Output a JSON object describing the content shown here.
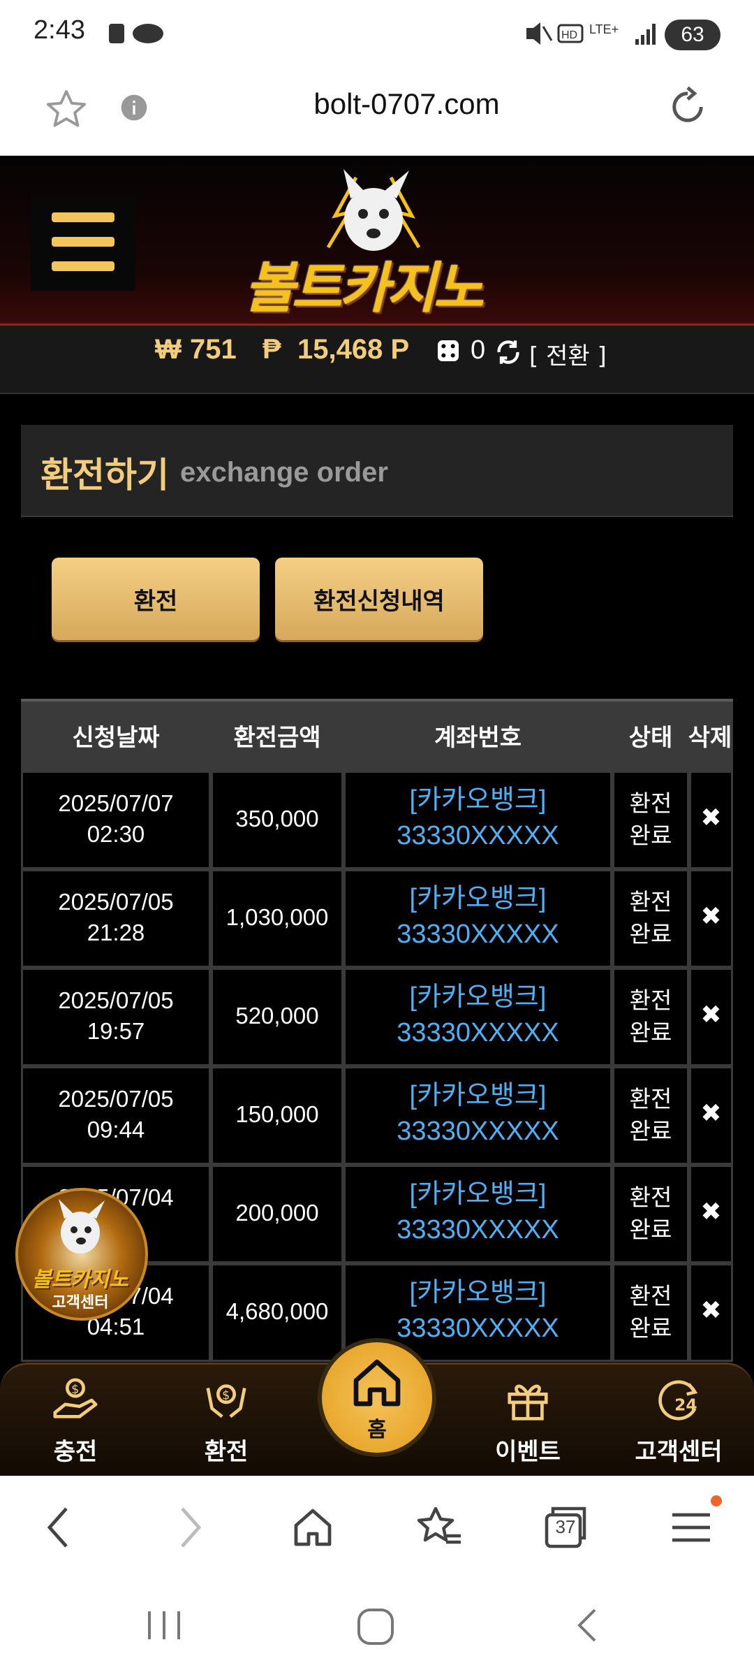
{
  "status_bar": {
    "time": "2:43",
    "battery": "63"
  },
  "browser": {
    "url": "bolt-0707.com",
    "tab_count": "37"
  },
  "site": {
    "logo_text": "볼트카지노",
    "balance": {
      "won_symbol": "₩",
      "won_value": "751",
      "point_symbol": "₱",
      "point_value": "15,468 P",
      "dice_value": "0",
      "convert_label": "[ 전환 ]"
    }
  },
  "exchange": {
    "title": "환전하기",
    "subtitle": "exchange order",
    "tabs": [
      "환전",
      "환전신청내역"
    ],
    "columns": [
      "신청날짜",
      "환전금액",
      "계좌번호",
      "상태",
      "삭제"
    ],
    "rows": [
      {
        "date": "2025/07/07",
        "time": "02:30",
        "amount": "350,000",
        "bank": "[카카오뱅크]",
        "account": "33330XXXXX",
        "status_1": "환전",
        "status_2": "완료"
      },
      {
        "date": "2025/07/05",
        "time": "21:28",
        "amount": "1,030,000",
        "bank": "[카카오뱅크]",
        "account": "33330XXXXX",
        "status_1": "환전",
        "status_2": "완료"
      },
      {
        "date": "2025/07/05",
        "time": "19:57",
        "amount": "520,000",
        "bank": "[카카오뱅크]",
        "account": "33330XXXXX",
        "status_1": "환전",
        "status_2": "완료"
      },
      {
        "date": "2025/07/05",
        "time": "09:44",
        "amount": "150,000",
        "bank": "[카카오뱅크]",
        "account": "33330XXXXX",
        "status_1": "환전",
        "status_2": "완료"
      },
      {
        "date": "2025/07/04",
        "time": "",
        "amount": "200,000",
        "bank": "[카카오뱅크]",
        "account": "33330XXXXX",
        "status_1": "환전",
        "status_2": "완료"
      },
      {
        "date": "2025/07/04",
        "time": "04:51",
        "amount": "4,680,000",
        "bank": "[카카오뱅크]",
        "account": "33330XXXXX",
        "status_1": "환전",
        "status_2": "완료"
      }
    ],
    "delete_symbol": "✖"
  },
  "floating_cs": {
    "line1": "볼트카지노",
    "line2": "고객센터"
  },
  "bottom_nav": {
    "charge": "충전",
    "exchange": "환전",
    "home": "홈",
    "event": "이벤트",
    "support": "고객센터"
  },
  "colors": {
    "accent_gold": "#f2cd7c",
    "link_blue": "#4fb0f5",
    "button_gold": "#e0b66c"
  }
}
